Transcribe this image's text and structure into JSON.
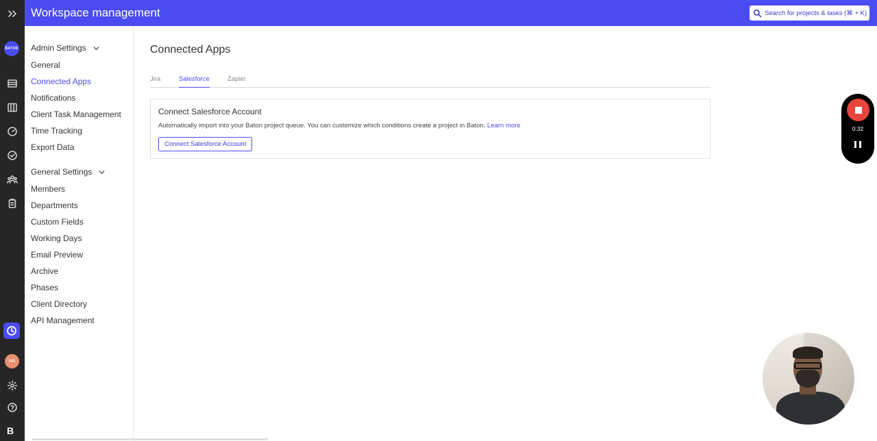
{
  "rail": {
    "logo_text": "BATON",
    "avatar_initials": "HA",
    "bottom_logo": "B"
  },
  "header": {
    "title": "Workspace management",
    "search_placeholder": "Search for projects & tasks (⌘ + K)"
  },
  "sidebar": {
    "admin_title": "Admin Settings",
    "admin_items": [
      "General",
      "Connected Apps",
      "Notifications",
      "Client Task Management",
      "Time Tracking",
      "Export Data"
    ],
    "general_title": "General Settings",
    "general_items": [
      "Members",
      "Departments",
      "Custom Fields",
      "Working Days",
      "Email Preview",
      "Archive",
      "Phases",
      "Client Directory",
      "API Management"
    ]
  },
  "main": {
    "page_title": "Connected Apps",
    "tabs": [
      "Jira",
      "Salesforce",
      "Zapier"
    ],
    "card": {
      "title": "Connect Salesforce Account",
      "description": "Automatically import into your Baton project queue. You can customize which conditions create a project in Baton.",
      "link_text": "Learn more",
      "button_label": "Connect Salesforce Account"
    }
  },
  "recorder": {
    "elapsed": "0:32"
  },
  "colors": {
    "accent": "#4a4cf2",
    "rail": "#262626",
    "record": "#e8453c"
  }
}
